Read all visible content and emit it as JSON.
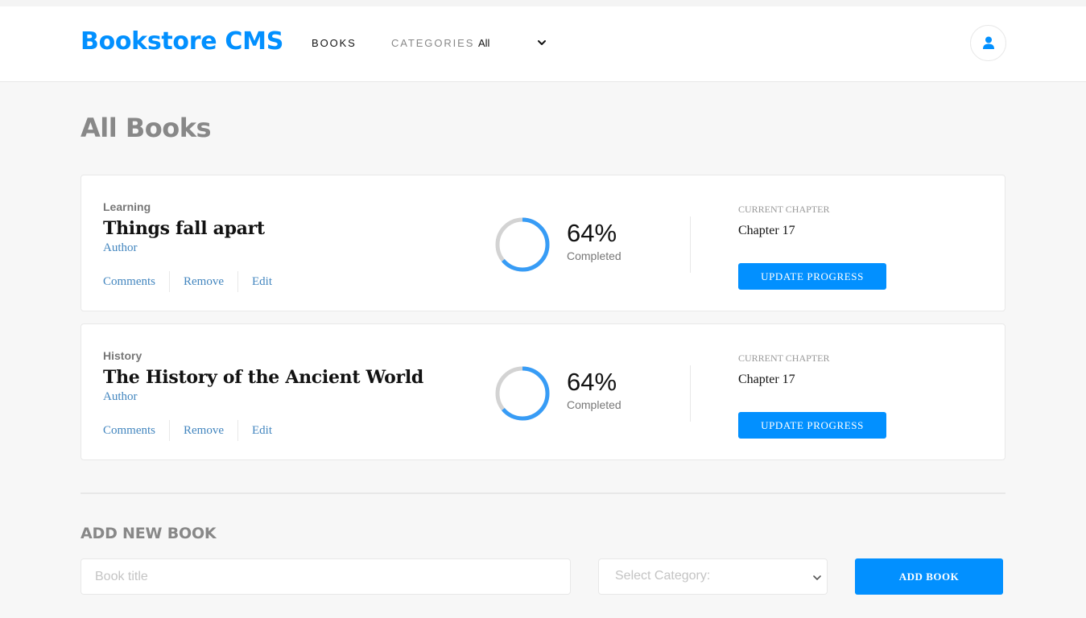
{
  "header": {
    "brand": "Bookstore CMS",
    "nav_books": "BOOKS",
    "nav_categories": "CATEGORIES",
    "categories_value": "All",
    "chevron_icon": "chevron-down-icon",
    "avatar_icon": "user-icon"
  },
  "page_title": "All Books",
  "books": [
    {
      "category": "Learning",
      "title": "Things fall apart",
      "author": "Author",
      "actions": [
        "Comments",
        "Remove",
        "Edit"
      ],
      "progress_percent": 64,
      "percent_label": "64%",
      "completed_label": "Completed",
      "chapter_label": "CURRENT CHAPTER",
      "chapter_value": "Chapter 17",
      "update_button": "UPDATE PROGRESS"
    },
    {
      "category": "History",
      "title": "The History of the Ancient World",
      "author": "Author",
      "actions": [
        "Comments",
        "Remove",
        "Edit"
      ],
      "progress_percent": 64,
      "percent_label": "64%",
      "completed_label": "Completed",
      "chapter_label": "CURRENT CHAPTER",
      "chapter_value": "Chapter 17",
      "update_button": "UPDATE PROGRESS"
    }
  ],
  "add_book": {
    "heading": "ADD NEW BOOK",
    "title_placeholder": "Book title",
    "category_placeholder": "Select Category:",
    "submit_label": "ADD BOOK"
  },
  "colors": {
    "accent": "#0290ff",
    "progress": "#379cf6",
    "progress_track": "#d3d3d3",
    "link": "#4386bf"
  }
}
